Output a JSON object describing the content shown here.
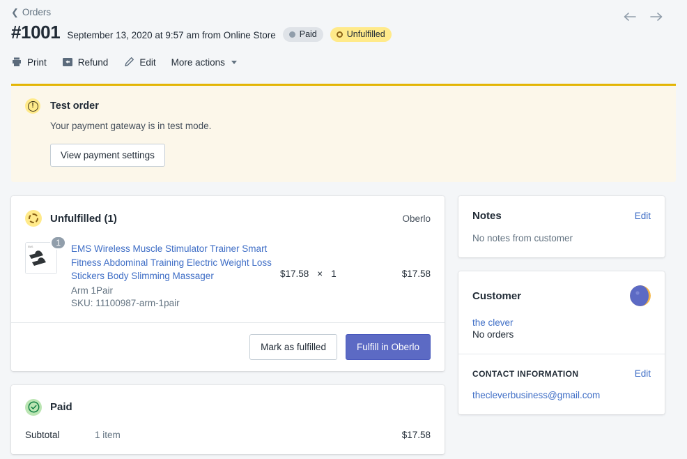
{
  "breadcrumb": {
    "label": "Orders",
    "icon": "chevron-left-icon"
  },
  "header": {
    "order_number": "#1001",
    "meta": "September 13, 2020 at 9:57 am from Online Store",
    "badges": [
      {
        "label": "Paid",
        "style": "paid"
      },
      {
        "label": "Unfulfilled",
        "style": "unfulfilled"
      }
    ],
    "prev_arrow": "←",
    "next_arrow": "→"
  },
  "toolbar": {
    "print_label": "Print",
    "refund_label": "Refund",
    "edit_label": "Edit",
    "more_label": "More actions"
  },
  "banner": {
    "title": "Test order",
    "text": "Your payment gateway is in test mode.",
    "button_label": "View payment settings",
    "accent_color": "#e3b505",
    "background_color": "#fcf7ea"
  },
  "fulfillment": {
    "title": "Unfulfilled (1)",
    "source": "Oberlo",
    "item": {
      "title": "EMS Wireless Muscle Stimulator Trainer Smart Fitness Abdominal Training Electric Weight Loss Stickers Body Slimming Massager",
      "variant": "Arm 1Pair",
      "sku": "SKU: 11100987-arm-1pair",
      "quantity_badge": "1",
      "unit_price": "$17.58",
      "multiply": "×",
      "quantity": "1",
      "line_total": "$17.58"
    },
    "mark_fulfilled_label": "Mark as fulfilled",
    "fulfill_oberlo_label": "Fulfill in Oberlo",
    "primary_color": "#5c6ac4"
  },
  "paid": {
    "title": "Paid",
    "subtotal_label": "Subtotal",
    "subtotal_items": "1 item",
    "subtotal_amount": "$17.58"
  },
  "notes": {
    "title": "Notes",
    "edit_label": "Edit",
    "body": "No notes from customer"
  },
  "customer": {
    "title": "Customer",
    "name": "the clever",
    "orders": "No orders",
    "contact_title": "Contact information",
    "contact_edit_label": "Edit",
    "email": "thecleverbusiness@gmail.com"
  }
}
